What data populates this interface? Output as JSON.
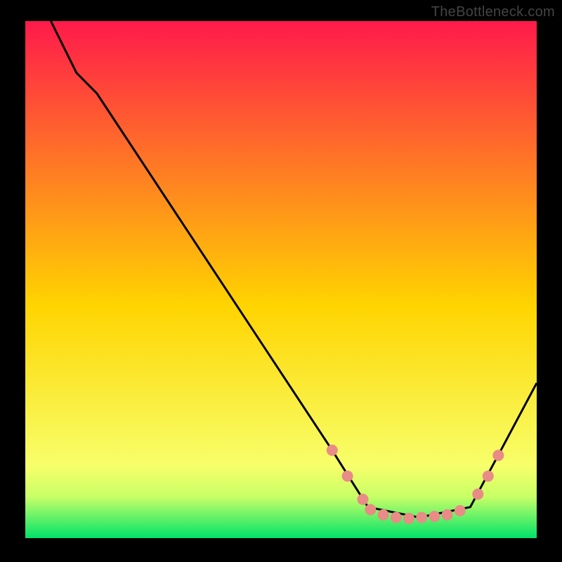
{
  "attribution": "TheBottleneck.com",
  "chart_data": {
    "type": "line",
    "title": "",
    "xlabel": "",
    "ylabel": "",
    "xlim": [
      0,
      100
    ],
    "ylim": [
      0,
      100
    ],
    "background_gradient": {
      "top_color": "#ff1a4b",
      "mid_color": "#ffd400",
      "low_color": "#f7ff6a",
      "base_color": "#00e36a"
    },
    "black_border": true,
    "series": [
      {
        "name": "bottleneck-curve",
        "color": "#000000",
        "x": [
          5,
          10,
          14,
          60,
          67,
          77,
          87,
          93,
          100
        ],
        "y": [
          100,
          90,
          86,
          17,
          6,
          4,
          6,
          17,
          30
        ]
      }
    ],
    "markers": {
      "name": "sweet-spot-markers",
      "color": "#e98b86",
      "radius": 8,
      "points": [
        {
          "x": 60.0,
          "y": 17.0
        },
        {
          "x": 63.0,
          "y": 12.0
        },
        {
          "x": 66.0,
          "y": 7.5
        },
        {
          "x": 67.5,
          "y": 5.5
        },
        {
          "x": 70.0,
          "y": 4.5
        },
        {
          "x": 72.5,
          "y": 4.0
        },
        {
          "x": 75.0,
          "y": 3.8
        },
        {
          "x": 77.5,
          "y": 4.0
        },
        {
          "x": 80.0,
          "y": 4.2
        },
        {
          "x": 82.5,
          "y": 4.5
        },
        {
          "x": 85.0,
          "y": 5.3
        },
        {
          "x": 88.5,
          "y": 8.5
        },
        {
          "x": 90.5,
          "y": 12.0
        },
        {
          "x": 92.5,
          "y": 16.0
        }
      ]
    }
  }
}
